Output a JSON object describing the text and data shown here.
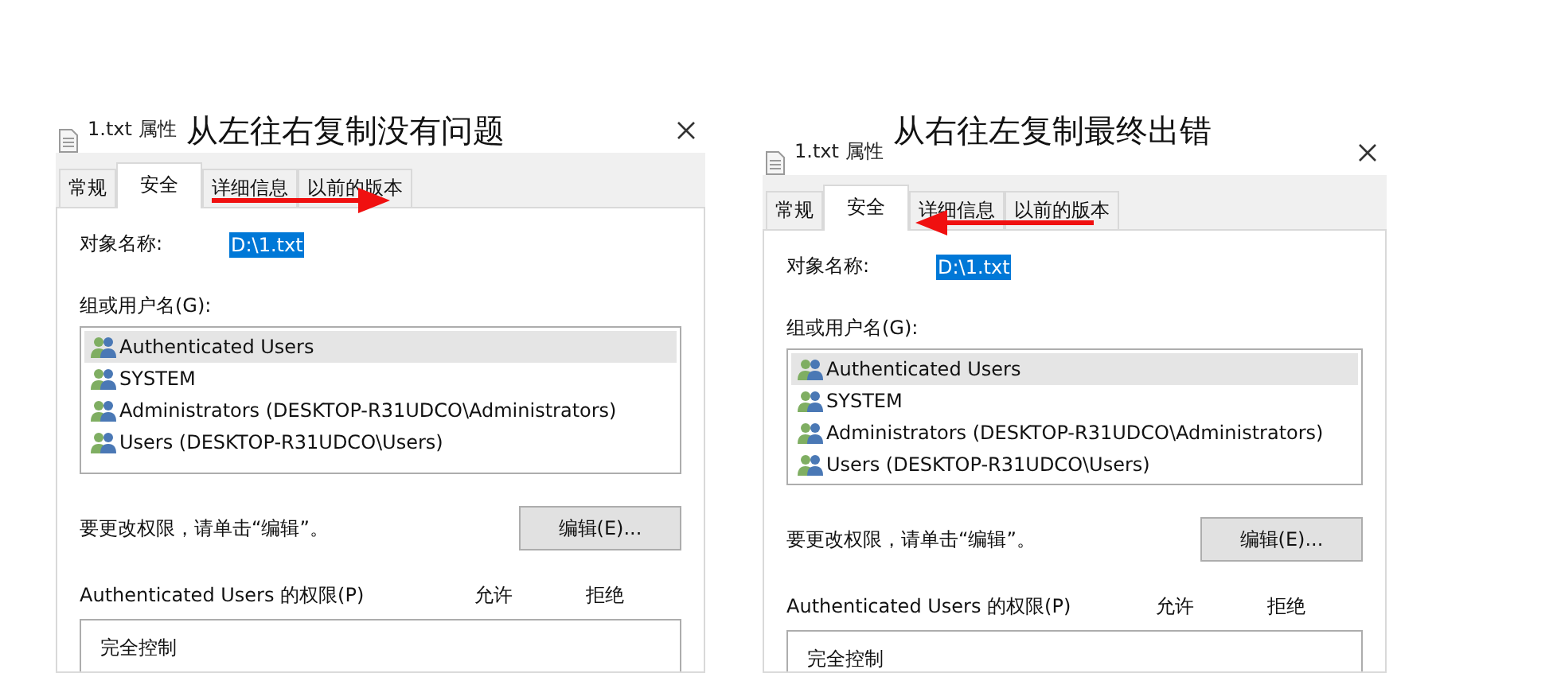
{
  "dialogs": [
    {
      "title": "1.txt 属性",
      "annotation": {
        "text": "从左往右复制没有问题",
        "kind": "rightward"
      },
      "tabs": [
        {
          "label": "常规",
          "selected": false
        },
        {
          "label": "安全",
          "selected": true
        },
        {
          "label": "详细信息",
          "selected": false
        },
        {
          "label": "以前的版本",
          "selected": false
        }
      ],
      "object_label": "对象名称:",
      "object_value": "D:\\1.txt",
      "object_value_selected": true,
      "groups_label": "组或用户名(G):",
      "users": [
        {
          "name": "Authenticated Users",
          "selected": true
        },
        {
          "name": "SYSTEM",
          "selected": false
        },
        {
          "name": "Administrators (DESKTOP-R31UDCO\\Administrators)",
          "selected": false
        },
        {
          "name": "Users (DESKTOP-R31UDCO\\Users)",
          "selected": false
        }
      ],
      "hint": "要更改权限，请单击“编辑”。",
      "edit_button": "编辑(E)...",
      "permissions_label": "Authenticated Users 的权限(P)",
      "allow_header": "允许",
      "deny_header": "拒绝",
      "permissions": [
        {
          "name": "完全控制"
        }
      ]
    },
    {
      "title": "1.txt 属性",
      "annotation": {
        "text": "从右往左复制最终出错",
        "kind": "leftward"
      },
      "tabs": [
        {
          "label": "常规",
          "selected": false
        },
        {
          "label": "安全",
          "selected": true
        },
        {
          "label": "详细信息",
          "selected": false
        },
        {
          "label": "以前的版本",
          "selected": false
        }
      ],
      "object_label": "对象名称:",
      "object_value": "D:\\1.txt",
      "object_value_selected": true,
      "groups_label": "组或用户名(G):",
      "users": [
        {
          "name": "Authenticated Users",
          "selected": true
        },
        {
          "name": "SYSTEM",
          "selected": false
        },
        {
          "name": "Administrators (DESKTOP-R31UDCO\\Administrators)",
          "selected": false
        },
        {
          "name": "Users (DESKTOP-R31UDCO\\Users)",
          "selected": false
        }
      ],
      "hint": "要更改权限，请单击“编辑”。",
      "edit_button": "编辑(E)...",
      "permissions_label": "Authenticated Users 的权限(P)",
      "allow_header": "允许",
      "deny_header": "拒绝",
      "permissions": [
        {
          "name": "完全控制"
        }
      ]
    }
  ]
}
